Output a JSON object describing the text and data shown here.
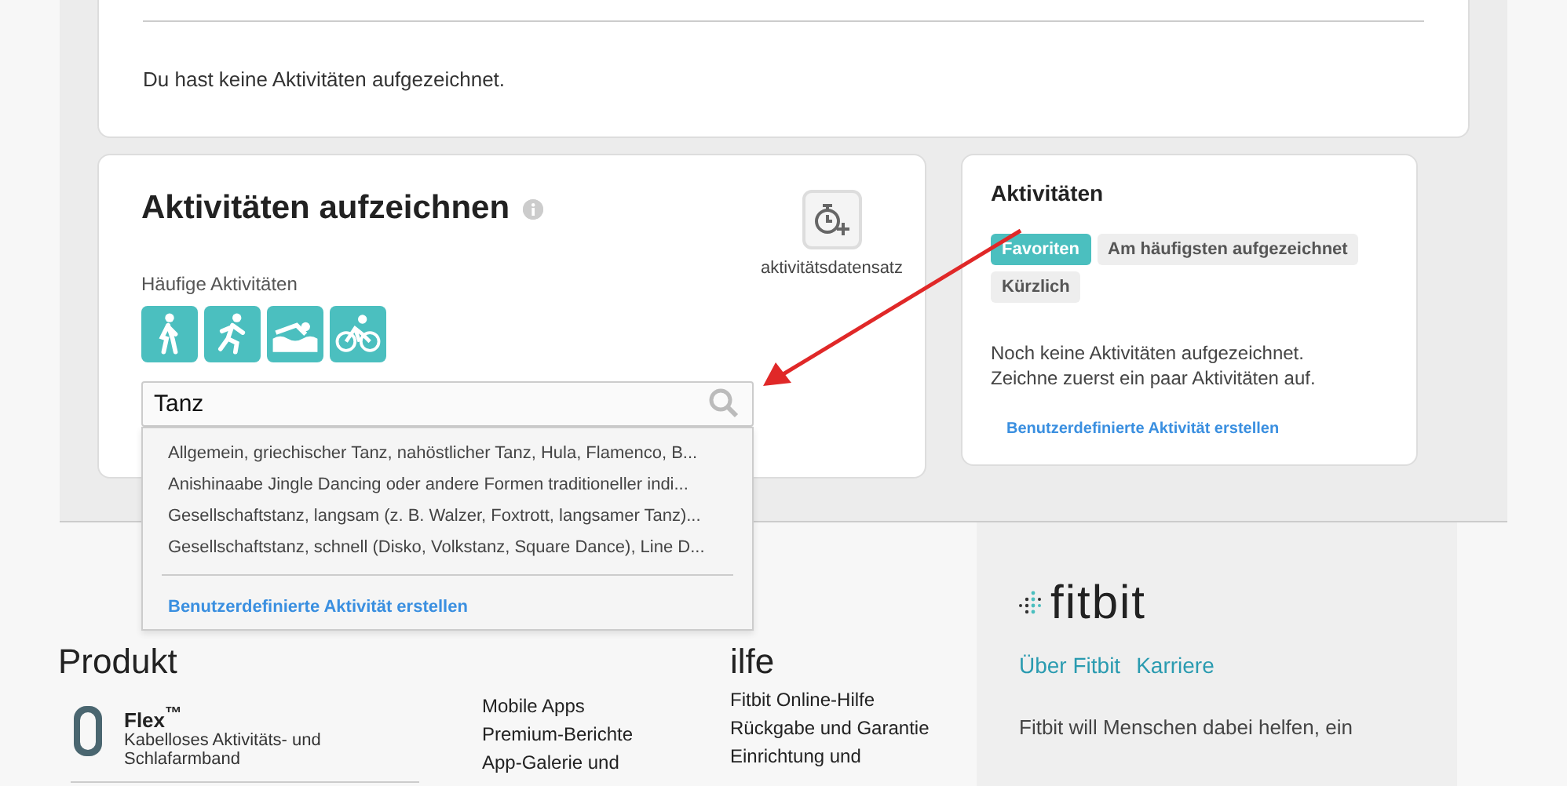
{
  "top_card": {
    "message": "Du hast keine Aktivitäten aufgezeichnet."
  },
  "log_card": {
    "title": "Aktivitäten aufzeichnen",
    "record_label": "aktivitätsdatensatz",
    "frequent_label": "Häufige Aktivitäten",
    "frequent_activities": [
      {
        "kind": "walk"
      },
      {
        "kind": "run"
      },
      {
        "kind": "swim"
      },
      {
        "kind": "bike"
      }
    ],
    "search": {
      "value": "Tanz"
    },
    "suggestions": [
      "Allgemein, griechischer Tanz, nahöstlicher Tanz, Hula, Flamenco, B...",
      "Anishinaabe Jingle Dancing oder andere Formen traditioneller indi...",
      "Gesellschaftstanz, langsam (z. B. Walzer, Foxtrott, langsamer Tanz)...",
      "Gesellschaftstanz, schnell (Disko, Volkstanz, Square Dance), Line D..."
    ],
    "create_link": "Benutzerdefinierte Aktivität erstellen"
  },
  "activities_card": {
    "title": "Aktivitäten",
    "tabs": [
      {
        "label": "Favoriten",
        "selected": true
      },
      {
        "label": "Am häufigsten aufgezeichnet",
        "selected": false
      },
      {
        "label": "Kürzlich",
        "selected": false
      }
    ],
    "empty_message": "Noch keine Aktivitäten aufgezeichnet. Zeichne zuerst ein paar Aktivitäten auf.",
    "create_link": "Benutzerdefinierte Aktivität erstellen"
  },
  "footer": {
    "products": {
      "heading": "Produkt",
      "name": "Flex$^{™}$",
      "description": "Kabelloses Aktivitäts- und Schlafarmband"
    },
    "services": {
      "links": [
        "Mobile Apps",
        "Premium-Berichte",
        "App-Galerie und"
      ]
    },
    "help": {
      "heading": "ilfe",
      "links": [
        "Fitbit Online-Hilfe",
        "Rückgabe und Garantie",
        "Einrichtung und"
      ]
    },
    "brand": {
      "logo_text": "fitbit",
      "links": [
        "Über Fitbit",
        "Karriere"
      ],
      "tagline": "Fitbit will Menschen dabei helfen, ein"
    }
  }
}
